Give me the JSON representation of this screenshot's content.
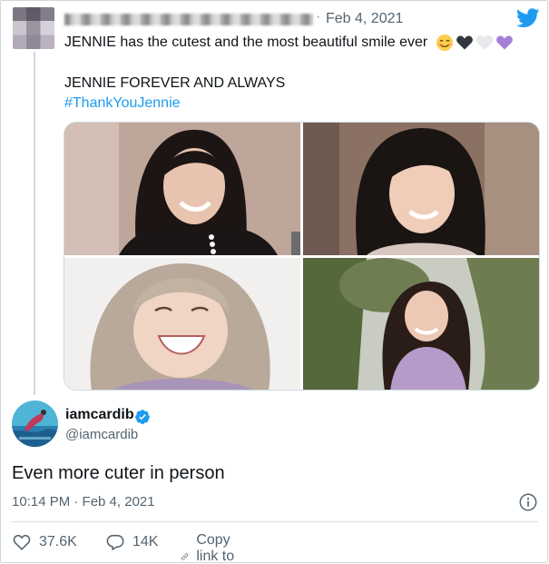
{
  "parent_tweet": {
    "date": "Feb 4, 2021",
    "text": "JENNIE has the cutest and the most beautiful smile ever",
    "emojis": [
      "smiling-face-with-heart-eyes-icon",
      "black-heart-icon",
      "white-heart-icon",
      "purple-heart-icon"
    ],
    "line2": "JENNIE FOREVER AND ALWAYS",
    "hashtag": "#ThankYouJennie"
  },
  "tweet": {
    "author_name": "iamcardib",
    "author_handle": "@iamcardib",
    "verified": true,
    "text": "Even more cuter in person",
    "timestamp": "10:14 PM · Feb 4, 2021"
  },
  "actions": {
    "likes": "37.6K",
    "replies": "14K",
    "copy_link": "Copy link to Tweet"
  },
  "colors": {
    "twitter_blue": "#1d9bf0",
    "text_secondary": "#536471",
    "heart_purple": "#a47fd8"
  }
}
